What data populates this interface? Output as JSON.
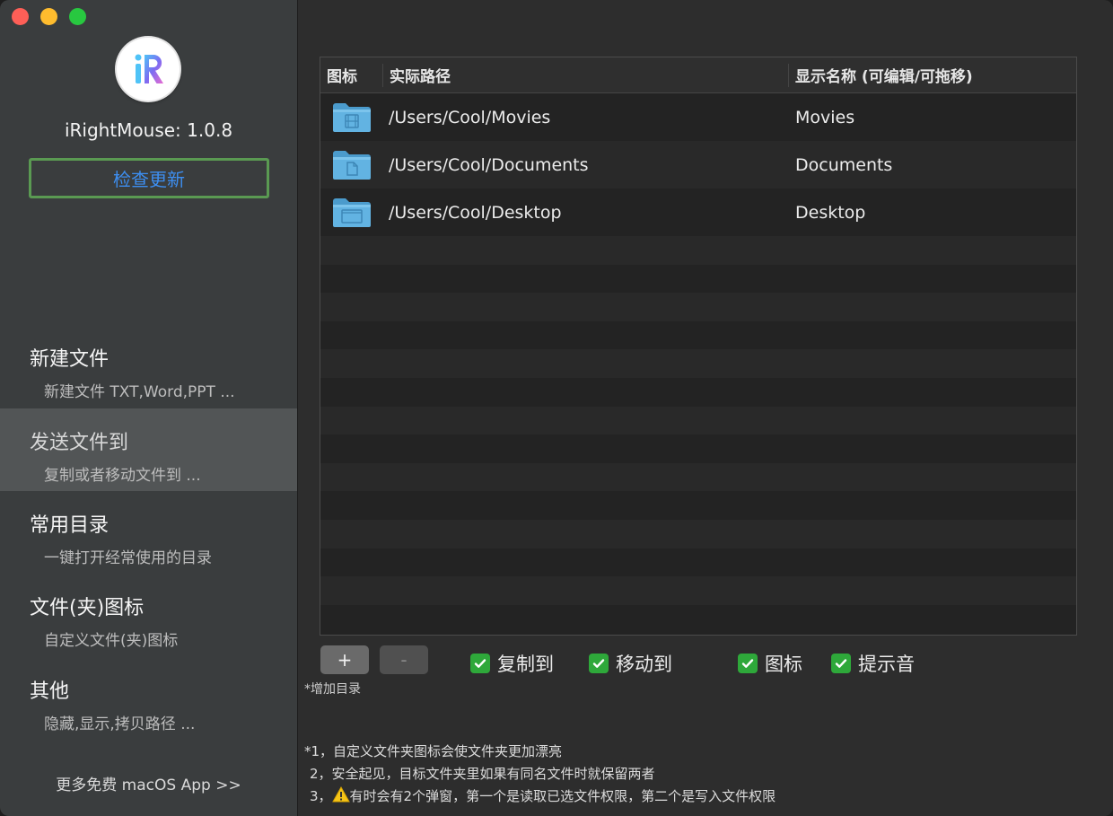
{
  "app": {
    "version_text": "iRightMouse: 1.0.8",
    "check_update": "检查更新",
    "more_apps": "更多免费 macOS App >>"
  },
  "nav": [
    {
      "title": "新建文件",
      "subtitle": "新建文件 TXT,Word,PPT ...",
      "active": false
    },
    {
      "title": "发送文件到",
      "subtitle": "复制或者移动文件到 ...",
      "active": true
    },
    {
      "title": "常用目录",
      "subtitle": "一键打开经常使用的目录",
      "active": false
    },
    {
      "title": "文件(夹)图标",
      "subtitle": "自定义文件(夹)图标",
      "active": false
    },
    {
      "title": "其他",
      "subtitle": "隐藏,显示,拷贝路径 ...",
      "active": false
    }
  ],
  "table": {
    "headers": {
      "icon": "图标",
      "path": "实际路径",
      "name": "显示名称 (可编辑/可拖移)"
    },
    "rows": [
      {
        "icon": "movies-folder-icon",
        "path": "/Users/Cool/Movies",
        "name": "Movies"
      },
      {
        "icon": "documents-folder-icon",
        "path": "/Users/Cool/Documents",
        "name": "Documents"
      },
      {
        "icon": "desktop-folder-icon",
        "path": "/Users/Cool/Desktop",
        "name": "Desktop"
      }
    ]
  },
  "controls": {
    "add_label": "+",
    "remove_label": "-",
    "add_hint": "*增加目录",
    "checkboxes": [
      {
        "label": "复制到",
        "checked": true
      },
      {
        "label": "移动到",
        "checked": true
      },
      {
        "label": "图标",
        "checked": true
      },
      {
        "label": "提示音",
        "checked": true
      }
    ]
  },
  "notes": {
    "line1": "*1，自定义文件夹图标会使文件夹更加漂亮",
    "line2": "2，安全起见，目标文件夹里如果有同名文件时就保留两者",
    "line3_prefix": "3，",
    "line3": "有时会有2个弹窗，第一个是读取已选文件权限，第二个是写入文件权限"
  },
  "colors": {
    "accent_link": "#3d8ef0",
    "update_border": "#5a9a52",
    "checkbox_green": "#2ea83a",
    "folder_blue": "#5fb0de"
  }
}
